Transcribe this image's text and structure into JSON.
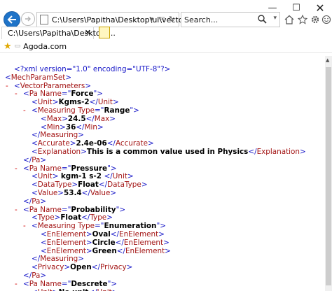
{
  "browser": {
    "address_url": "C:\\Users\\Papitha\\Desktop\\ul\\vector.xml",
    "search_placeholder": "Search...",
    "tab_title": "C:\\Users\\Papitha\\Desktop\\...",
    "favorite_label": "Agoda.com",
    "window_controls": {
      "minimize": "—",
      "maximize": "☐",
      "close": "✕"
    }
  },
  "xml": {
    "declaration": "<?xml version=\"1.0\" encoding=\"UTF-8\"?>",
    "lines": [
      {
        "marker": "",
        "parts": [
          {
            "t": "<?xml version=\"1.0\" encoding=\"UTF-8\"?>",
            "k": "pi"
          }
        ]
      },
      {
        "marker": "-",
        "parts": [
          {
            "t": "<",
            "k": "br"
          },
          {
            "t": "MechParamSet",
            "k": "tg"
          },
          {
            "t": ">",
            "k": "br"
          }
        ]
      },
      {
        "marker": "-",
        "parts": [
          {
            "t": "<",
            "k": "br"
          },
          {
            "t": "VectorParameters",
            "k": "tg"
          },
          {
            "t": ">",
            "k": "br"
          }
        ]
      },
      {
        "marker": "-",
        "parts": [
          {
            "t": "<",
            "k": "br"
          },
          {
            "t": "Pa ",
            "k": "tg"
          },
          {
            "t": "Name",
            "k": "an"
          },
          {
            "t": "=\"",
            "k": "br"
          },
          {
            "t": "Force",
            "k": "tx"
          },
          {
            "t": "\">",
            "k": "br"
          }
        ]
      },
      {
        "marker": "",
        "parts": [
          {
            "t": "<",
            "k": "br"
          },
          {
            "t": "Unit",
            "k": "tg"
          },
          {
            "t": ">",
            "k": "br"
          },
          {
            "t": "Kgms-2",
            "k": "tx"
          },
          {
            "t": "</",
            "k": "br"
          },
          {
            "t": "Unit",
            "k": "tg"
          },
          {
            "t": ">",
            "k": "br"
          }
        ]
      },
      {
        "marker": "-",
        "parts": [
          {
            "t": "<",
            "k": "br"
          },
          {
            "t": "Measuring ",
            "k": "tg"
          },
          {
            "t": "Type",
            "k": "an"
          },
          {
            "t": "=\"",
            "k": "br"
          },
          {
            "t": "Range",
            "k": "tx"
          },
          {
            "t": "\">",
            "k": "br"
          }
        ]
      },
      {
        "marker": "",
        "parts": [
          {
            "t": "<",
            "k": "br"
          },
          {
            "t": "Max",
            "k": "tg"
          },
          {
            "t": ">",
            "k": "br"
          },
          {
            "t": "24.5",
            "k": "tx"
          },
          {
            "t": "</",
            "k": "br"
          },
          {
            "t": "Max",
            "k": "tg"
          },
          {
            "t": ">",
            "k": "br"
          }
        ]
      },
      {
        "marker": "",
        "parts": [
          {
            "t": "<",
            "k": "br"
          },
          {
            "t": "Min",
            "k": "tg"
          },
          {
            "t": ">",
            "k": "br"
          },
          {
            "t": "36",
            "k": "tx"
          },
          {
            "t": "</",
            "k": "br"
          },
          {
            "t": "Min",
            "k": "tg"
          },
          {
            "t": ">",
            "k": "br"
          }
        ]
      },
      {
        "marker": "",
        "parts": [
          {
            "t": "</",
            "k": "br"
          },
          {
            "t": "Measuring",
            "k": "tg"
          },
          {
            "t": ">",
            "k": "br"
          }
        ]
      },
      {
        "marker": "",
        "parts": [
          {
            "t": "<",
            "k": "br"
          },
          {
            "t": "Accurate",
            "k": "tg"
          },
          {
            "t": ">",
            "k": "br"
          },
          {
            "t": "2.4e-06",
            "k": "tx"
          },
          {
            "t": "</",
            "k": "br"
          },
          {
            "t": "Accurate",
            "k": "tg"
          },
          {
            "t": ">",
            "k": "br"
          }
        ]
      },
      {
        "marker": "",
        "parts": [
          {
            "t": "<",
            "k": "br"
          },
          {
            "t": "Explanation",
            "k": "tg"
          },
          {
            "t": ">",
            "k": "br"
          },
          {
            "t": "This is a common value used in Physics",
            "k": "tx"
          },
          {
            "t": "</",
            "k": "br"
          },
          {
            "t": "Explanation",
            "k": "tg"
          },
          {
            "t": ">",
            "k": "br"
          }
        ]
      },
      {
        "marker": "",
        "parts": [
          {
            "t": "</",
            "k": "br"
          },
          {
            "t": "Pa",
            "k": "tg"
          },
          {
            "t": ">",
            "k": "br"
          }
        ]
      },
      {
        "marker": "-",
        "parts": [
          {
            "t": "<",
            "k": "br"
          },
          {
            "t": "Pa ",
            "k": "tg"
          },
          {
            "t": "Name",
            "k": "an"
          },
          {
            "t": "=\"",
            "k": "br"
          },
          {
            "t": "Pressure",
            "k": "tx"
          },
          {
            "t": "\">",
            "k": "br"
          }
        ]
      },
      {
        "marker": "",
        "parts": [
          {
            "t": "<",
            "k": "br"
          },
          {
            "t": "Unit",
            "k": "tg"
          },
          {
            "t": "> ",
            "k": "br"
          },
          {
            "t": "kgm-1 s-2 ",
            "k": "tx"
          },
          {
            "t": "</",
            "k": "br"
          },
          {
            "t": "Unit",
            "k": "tg"
          },
          {
            "t": ">",
            "k": "br"
          }
        ]
      },
      {
        "marker": "",
        "parts": [
          {
            "t": "<",
            "k": "br"
          },
          {
            "t": "DataType",
            "k": "tg"
          },
          {
            "t": ">",
            "k": "br"
          },
          {
            "t": "Float",
            "k": "tx"
          },
          {
            "t": "</",
            "k": "br"
          },
          {
            "t": "DataType",
            "k": "tg"
          },
          {
            "t": ">",
            "k": "br"
          }
        ]
      },
      {
        "marker": "",
        "parts": [
          {
            "t": "<",
            "k": "br"
          },
          {
            "t": "Value",
            "k": "tg"
          },
          {
            "t": ">",
            "k": "br"
          },
          {
            "t": "53.4",
            "k": "tx"
          },
          {
            "t": "</",
            "k": "br"
          },
          {
            "t": "Value",
            "k": "tg"
          },
          {
            "t": ">",
            "k": "br"
          }
        ]
      },
      {
        "marker": "",
        "parts": [
          {
            "t": "</",
            "k": "br"
          },
          {
            "t": "Pa",
            "k": "tg"
          },
          {
            "t": ">",
            "k": "br"
          }
        ]
      },
      {
        "marker": "-",
        "parts": [
          {
            "t": "<",
            "k": "br"
          },
          {
            "t": "Pa ",
            "k": "tg"
          },
          {
            "t": "Name",
            "k": "an"
          },
          {
            "t": "=\"",
            "k": "br"
          },
          {
            "t": "Probability",
            "k": "tx"
          },
          {
            "t": "\">",
            "k": "br"
          }
        ]
      },
      {
        "marker": "",
        "parts": [
          {
            "t": "<",
            "k": "br"
          },
          {
            "t": "Type",
            "k": "tg"
          },
          {
            "t": ">",
            "k": "br"
          },
          {
            "t": "Float",
            "k": "tx"
          },
          {
            "t": "</",
            "k": "br"
          },
          {
            "t": "Type",
            "k": "tg"
          },
          {
            "t": ">",
            "k": "br"
          }
        ]
      },
      {
        "marker": "-",
        "parts": [
          {
            "t": "<",
            "k": "br"
          },
          {
            "t": "Measuring ",
            "k": "tg"
          },
          {
            "t": "Type",
            "k": "an"
          },
          {
            "t": "=\"",
            "k": "br"
          },
          {
            "t": "Enumeration",
            "k": "tx"
          },
          {
            "t": "\">",
            "k": "br"
          }
        ]
      },
      {
        "marker": "",
        "parts": [
          {
            "t": "<",
            "k": "br"
          },
          {
            "t": "EnElement",
            "k": "tg"
          },
          {
            "t": ">",
            "k": "br"
          },
          {
            "t": "Oval",
            "k": "tx"
          },
          {
            "t": "</",
            "k": "br"
          },
          {
            "t": "EnElement",
            "k": "tg"
          },
          {
            "t": ">",
            "k": "br"
          }
        ]
      },
      {
        "marker": "",
        "parts": [
          {
            "t": "<",
            "k": "br"
          },
          {
            "t": "EnElement",
            "k": "tg"
          },
          {
            "t": ">",
            "k": "br"
          },
          {
            "t": "Circle",
            "k": "tx"
          },
          {
            "t": "</",
            "k": "br"
          },
          {
            "t": "EnElement",
            "k": "tg"
          },
          {
            "t": ">",
            "k": "br"
          }
        ]
      },
      {
        "marker": "",
        "parts": [
          {
            "t": "<",
            "k": "br"
          },
          {
            "t": "EnElement",
            "k": "tg"
          },
          {
            "t": ">",
            "k": "br"
          },
          {
            "t": "Green",
            "k": "tx"
          },
          {
            "t": "</",
            "k": "br"
          },
          {
            "t": "EnElement",
            "k": "tg"
          },
          {
            "t": ">",
            "k": "br"
          }
        ]
      },
      {
        "marker": "",
        "parts": [
          {
            "t": "</",
            "k": "br"
          },
          {
            "t": "Measuring",
            "k": "tg"
          },
          {
            "t": ">",
            "k": "br"
          }
        ]
      },
      {
        "marker": "",
        "parts": [
          {
            "t": "<",
            "k": "br"
          },
          {
            "t": "Privacy",
            "k": "tg"
          },
          {
            "t": ">",
            "k": "br"
          },
          {
            "t": "Open",
            "k": "tx"
          },
          {
            "t": "</",
            "k": "br"
          },
          {
            "t": "Privacy",
            "k": "tg"
          },
          {
            "t": ">",
            "k": "br"
          }
        ]
      },
      {
        "marker": "",
        "parts": [
          {
            "t": "</",
            "k": "br"
          },
          {
            "t": "Pa",
            "k": "tg"
          },
          {
            "t": ">",
            "k": "br"
          }
        ]
      },
      {
        "marker": "-",
        "parts": [
          {
            "t": "<",
            "k": "br"
          },
          {
            "t": "Pa ",
            "k": "tg"
          },
          {
            "t": "Name",
            "k": "an"
          },
          {
            "t": "=\"",
            "k": "br"
          },
          {
            "t": "Descrete",
            "k": "tx"
          },
          {
            "t": "\">",
            "k": "br"
          }
        ]
      },
      {
        "marker": "",
        "parts": [
          {
            "t": "<",
            "k": "br"
          },
          {
            "t": "Unit",
            "k": "tg"
          },
          {
            "t": ">",
            "k": "br"
          },
          {
            "t": "No unit",
            "k": "tx"
          },
          {
            "t": "</",
            "k": "br"
          },
          {
            "t": "Unit",
            "k": "tg"
          },
          {
            "t": ">",
            "k": "br"
          }
        ]
      }
    ]
  },
  "colors": {
    "markup_blue": "#1818c8",
    "tag_red": "#a31515",
    "collapse_marker_red": "#d00000",
    "back_button_blue": "#1e73c8"
  },
  "icons": [
    "back-arrow-icon",
    "forward-arrow-icon",
    "page-icon",
    "search-icon",
    "home-icon",
    "star-icon",
    "gear-icon",
    "smiley-icon",
    "ie-logo-icon",
    "new-tab-icon",
    "favorites-star-icon"
  ]
}
